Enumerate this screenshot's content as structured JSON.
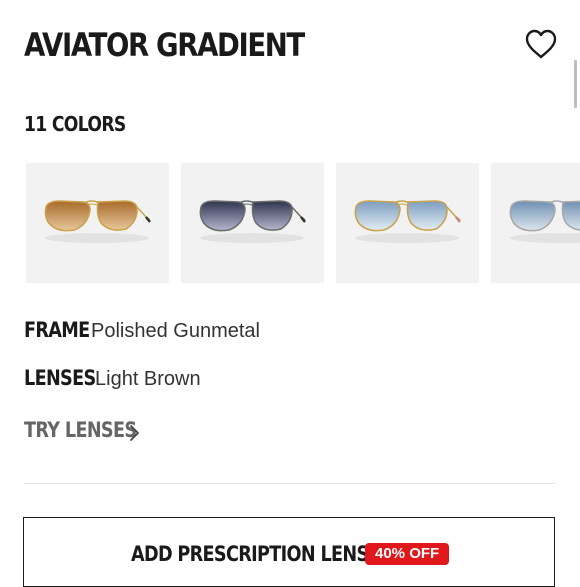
{
  "product": {
    "title": "AVIATOR GRADIENT",
    "favorite_icon": "heart-outline-icon",
    "colors_count": "11 COLORS"
  },
  "swatches": [
    {
      "name": "gold-frame-light-brown-gradient",
      "lens_color": "#b07a3e",
      "frame_color": "#c9a24a"
    },
    {
      "name": "gunmetal-frame-blue-gradient",
      "lens_color": "#5a5f78",
      "frame_color": "#6b6b6b"
    },
    {
      "name": "gold-frame-light-blue-gradient",
      "lens_color": "#9db6cf",
      "frame_color": "#c9a24a"
    },
    {
      "name": "silver-frame-light-blue-gradient",
      "lens_color": "#8ea7c0",
      "frame_color": "#a7a7a7"
    }
  ],
  "attributes": {
    "frame_label": "FRAME",
    "frame_value": "Polished Gunmetal",
    "lenses_label": "LENSES",
    "lenses_value": "Light Brown"
  },
  "try_lenses": {
    "label": "TRY LENSES",
    "icon": "chevron-right-icon"
  },
  "prescription": {
    "label": "ADD PRESCRIPTION LENSES",
    "badge": "40% OFF"
  },
  "colors": {
    "badge_red": "#e0181c",
    "text": "#1a1a1a",
    "swatch_bg": "#f2f2f2",
    "muted": "#666666"
  }
}
